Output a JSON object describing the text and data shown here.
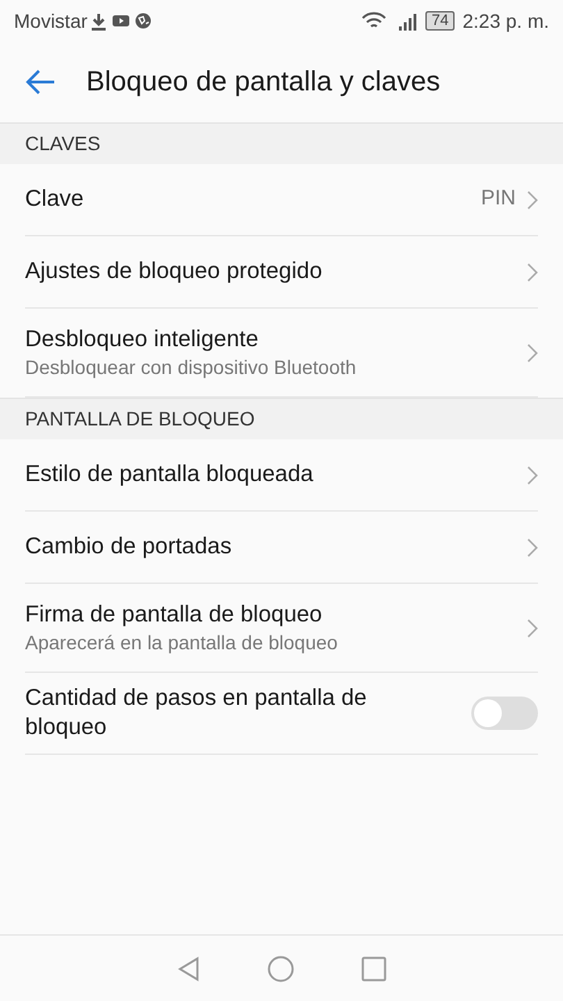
{
  "status_bar": {
    "carrier": "Movistar",
    "battery": "74",
    "time": "2:23 p. m."
  },
  "header": {
    "title": "Bloqueo de pantalla y claves"
  },
  "sections": [
    {
      "title": "CLAVES",
      "items": [
        {
          "kind": "chevron",
          "label": "Clave",
          "value": "PIN"
        },
        {
          "kind": "chevron",
          "label": "Ajustes de bloqueo protegido"
        },
        {
          "kind": "chevron",
          "label": "Desbloqueo inteligente",
          "subtitle": "Desbloquear con dispositivo Bluetooth"
        }
      ]
    },
    {
      "title": "PANTALLA DE BLOQUEO",
      "items": [
        {
          "kind": "chevron",
          "label": "Estilo de pantalla bloqueada"
        },
        {
          "kind": "chevron",
          "label": "Cambio de portadas"
        },
        {
          "kind": "chevron",
          "label": "Firma de pantalla de bloqueo",
          "subtitle": "Aparecerá en la pantalla de bloqueo"
        },
        {
          "kind": "toggle",
          "label": "Cantidad de pasos en pantalla de bloqueo",
          "on": false
        }
      ]
    }
  ]
}
